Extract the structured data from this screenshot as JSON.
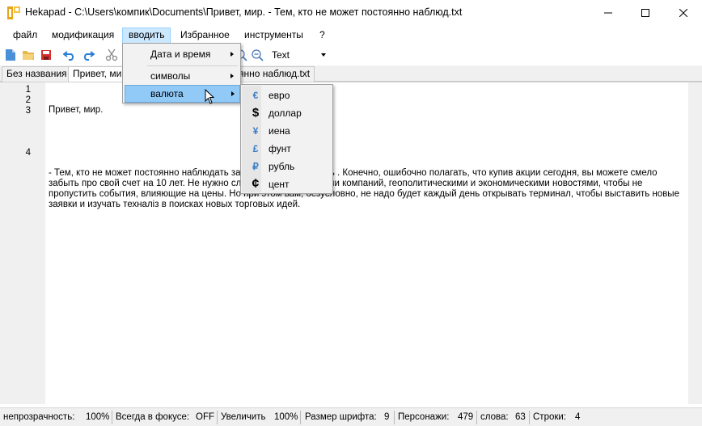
{
  "window": {
    "title": "Hekapad - C:\\Users\\компик\\Documents\\Привет, мир.  - Тем, кто не может постоянно наблюд.txt"
  },
  "menubar": {
    "items": [
      "файл",
      "модификация",
      "вводить",
      "Избранное",
      "инструменты",
      "?"
    ],
    "active": "вводить"
  },
  "toolbar": {
    "font_select": "Text"
  },
  "tabs": [
    {
      "label": "Без названия"
    },
    {
      "label": "Привет, мир"
    },
    {
      "label": "янно наблюд.txt"
    }
  ],
  "editor": {
    "line_numbers": [
      "1",
      "2",
      "3",
      "4"
    ],
    "lines": [
      "Привет, мир.",
      "",
      "- Тем, кто не может постоянно наблюдать за рынком каждый день . Конечно, ошибочно полагать, что купив акции сегодня, вы можете смело забыть про свой счет на 10 лет. Не нужно следить за отчетностями компаний, геополитическими и экономическими новостями, чтобы не пропустить события, влияющие на цены. Но при этом вам, безусловно, не надо будет каждый день открывать терминал, чтобы выставить новые заявки и изучать техналіз в поисках новых торговых идей.",
      ""
    ]
  },
  "insert_menu": {
    "items": [
      {
        "label": "Дата и время"
      },
      {
        "label": "символы"
      },
      {
        "label": "валюта"
      }
    ]
  },
  "currency_menu": {
    "items": [
      {
        "symbol": "€",
        "label": "евро"
      },
      {
        "symbol": "$",
        "label": "доллар"
      },
      {
        "symbol": "¥",
        "label": "иена"
      },
      {
        "symbol": "£",
        "label": "фунт"
      },
      {
        "symbol": "₽",
        "label": "рубль"
      },
      {
        "symbol": "¢",
        "label": "цент"
      }
    ]
  },
  "statusbar": {
    "opacity_label": "непрозрачность:",
    "opacity_value": "100%",
    "focus_label": "Всегда в фокусе:",
    "focus_value": "OFF",
    "zoom_label": "Увеличить",
    "zoom_value": "100%",
    "fontsize_label": "Размер шрифта:",
    "fontsize_value": "9",
    "chars_label": "Персонажи:",
    "chars_value": "479",
    "words_label": "слова:",
    "words_value": "63",
    "lines_label": "Строки:",
    "lines_value": "4"
  },
  "colors": {
    "menu_highlight": "#91c9f7",
    "menubar_active": "#cce8ff",
    "chrome_bg": "#f0f0f0"
  }
}
